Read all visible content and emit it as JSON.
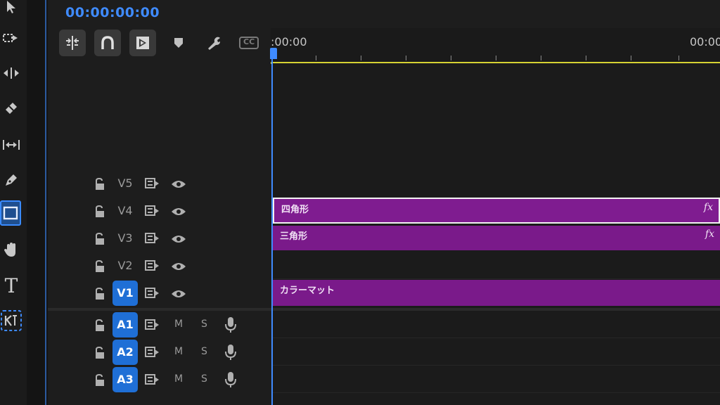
{
  "timecode": "00:00:00:00",
  "ruler": {
    "start_label": ":00:00",
    "end_label": "00:00"
  },
  "header_tools": [
    "nest-sequence-icon",
    "snap-icon",
    "linked-selection-icon",
    "add-marker-icon",
    "settings-wrench-icon",
    "captions-icon"
  ],
  "header_captions_label": "CC",
  "toolbar": [
    "selection-tool",
    "track-select-tool",
    "ripple-edit-tool",
    "razor-tool",
    "slip-tool",
    "pen-tool",
    "rectangle-tool",
    "hand-tool",
    "type-tool",
    "remix-tool"
  ],
  "toolbar_active": "rectangle-tool",
  "tools_text": {
    "type": "T"
  },
  "video_tracks": [
    {
      "name": "V5",
      "active": false
    },
    {
      "name": "V4",
      "active": false
    },
    {
      "name": "V3",
      "active": false
    },
    {
      "name": "V2",
      "active": false
    },
    {
      "name": "V1",
      "active": true
    }
  ],
  "audio_tracks": [
    {
      "name": "A1",
      "mute": "M",
      "solo": "S",
      "active": true
    },
    {
      "name": "A2",
      "mute": "M",
      "solo": "S",
      "active": true
    },
    {
      "name": "A3",
      "mute": "M",
      "solo": "S",
      "active": true
    }
  ],
  "clips": [
    {
      "track": "V4",
      "name": "四角形",
      "fx": "fx",
      "selected": true
    },
    {
      "track": "V3",
      "name": "三角形",
      "fx": "fx",
      "selected": false
    },
    {
      "track": "V1",
      "name": "カラーマット",
      "fx": "",
      "selected": false
    }
  ],
  "colors": {
    "accent": "#3f8bff",
    "clip": "#7a1a8a",
    "work_area": "#d6d233"
  }
}
